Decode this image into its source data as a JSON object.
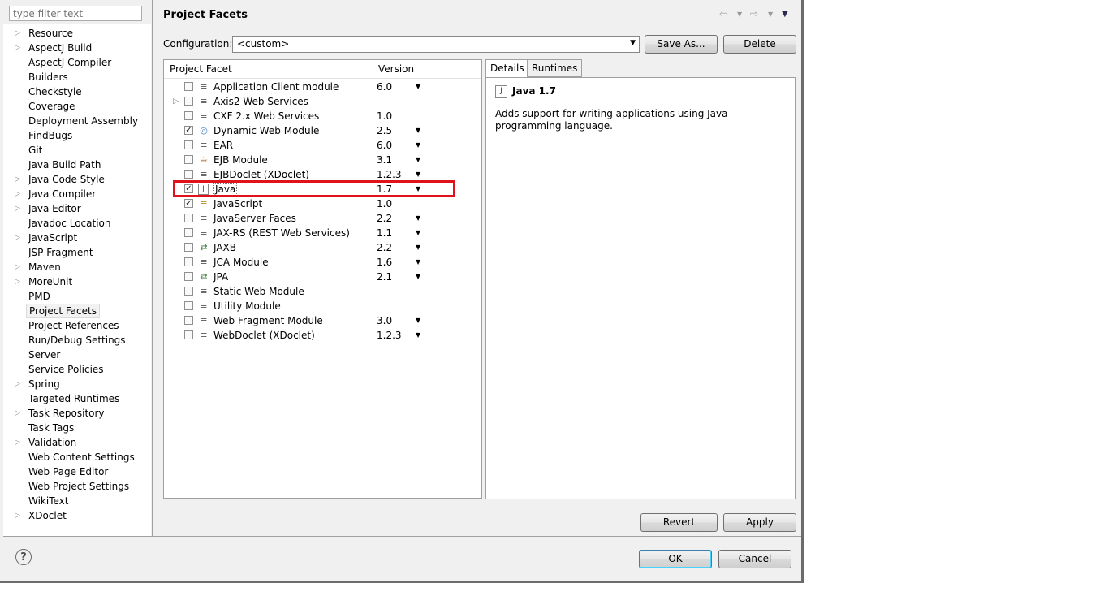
{
  "filter": {
    "placeholder": "type filter text"
  },
  "tree": {
    "items": [
      {
        "label": "Resource",
        "expandable": true
      },
      {
        "label": "AspectJ Build",
        "expandable": true
      },
      {
        "label": "AspectJ Compiler",
        "expandable": false
      },
      {
        "label": "Builders",
        "expandable": false
      },
      {
        "label": "Checkstyle",
        "expandable": false
      },
      {
        "label": "Coverage",
        "expandable": false
      },
      {
        "label": "Deployment Assembly",
        "expandable": false
      },
      {
        "label": "FindBugs",
        "expandable": false
      },
      {
        "label": "Git",
        "expandable": false
      },
      {
        "label": "Java Build Path",
        "expandable": false
      },
      {
        "label": "Java Code Style",
        "expandable": true
      },
      {
        "label": "Java Compiler",
        "expandable": true
      },
      {
        "label": "Java Editor",
        "expandable": true
      },
      {
        "label": "Javadoc Location",
        "expandable": false
      },
      {
        "label": "JavaScript",
        "expandable": true
      },
      {
        "label": "JSP Fragment",
        "expandable": false
      },
      {
        "label": "Maven",
        "expandable": true
      },
      {
        "label": "MoreUnit",
        "expandable": true
      },
      {
        "label": "PMD",
        "expandable": false
      },
      {
        "label": "Project Facets",
        "expandable": false,
        "selected": true
      },
      {
        "label": "Project References",
        "expandable": false
      },
      {
        "label": "Run/Debug Settings",
        "expandable": false
      },
      {
        "label": "Server",
        "expandable": false
      },
      {
        "label": "Service Policies",
        "expandable": false
      },
      {
        "label": "Spring",
        "expandable": true
      },
      {
        "label": "Targeted Runtimes",
        "expandable": false
      },
      {
        "label": "Task Repository",
        "expandable": true
      },
      {
        "label": "Task Tags",
        "expandable": false
      },
      {
        "label": "Validation",
        "expandable": true
      },
      {
        "label": "Web Content Settings",
        "expandable": false
      },
      {
        "label": "Web Page Editor",
        "expandable": false
      },
      {
        "label": "Web Project Settings",
        "expandable": false
      },
      {
        "label": "WikiText",
        "expandable": false
      },
      {
        "label": "XDoclet",
        "expandable": true
      }
    ]
  },
  "page": {
    "title": "Project Facets"
  },
  "config": {
    "label": "Configuration:",
    "value": "<custom>",
    "save_as": "Save As...",
    "delete": "Delete"
  },
  "facets": {
    "header": {
      "facet": "Project Facet",
      "version": "Version"
    },
    "rows": [
      {
        "name": "Application Client module",
        "version": "6.0",
        "checked": false,
        "dropdown": true,
        "expandable": false,
        "icon": "doc-icon"
      },
      {
        "name": "Axis2 Web Services",
        "version": "",
        "checked": false,
        "dropdown": false,
        "expandable": true,
        "icon": "doc-icon"
      },
      {
        "name": "CXF 2.x Web Services",
        "version": "1.0",
        "checked": false,
        "dropdown": false,
        "expandable": false,
        "icon": "doc-icon"
      },
      {
        "name": "Dynamic Web Module",
        "version": "2.5",
        "checked": true,
        "dropdown": true,
        "expandable": false,
        "icon": "globe-icon"
      },
      {
        "name": "EAR",
        "version": "6.0",
        "checked": false,
        "dropdown": true,
        "expandable": false,
        "icon": "doc-icon"
      },
      {
        "name": "EJB Module",
        "version": "3.1",
        "checked": false,
        "dropdown": true,
        "expandable": false,
        "icon": "bean-icon"
      },
      {
        "name": "EJBDoclet (XDoclet)",
        "version": "1.2.3",
        "checked": false,
        "dropdown": true,
        "expandable": false,
        "icon": "doc-icon"
      },
      {
        "name": "Java",
        "version": "1.7",
        "checked": true,
        "dropdown": true,
        "expandable": false,
        "icon": "java-icon",
        "highlighted": true
      },
      {
        "name": "JavaScript",
        "version": "1.0",
        "checked": true,
        "dropdown": false,
        "expandable": false,
        "icon": "lock-doc-icon"
      },
      {
        "name": "JavaServer Faces",
        "version": "2.2",
        "checked": false,
        "dropdown": true,
        "expandable": false,
        "icon": "doc-icon"
      },
      {
        "name": "JAX-RS (REST Web Services)",
        "version": "1.1",
        "checked": false,
        "dropdown": true,
        "expandable": false,
        "icon": "doc-icon"
      },
      {
        "name": "JAXB",
        "version": "2.2",
        "checked": false,
        "dropdown": true,
        "expandable": false,
        "icon": "arrows-icon"
      },
      {
        "name": "JCA Module",
        "version": "1.6",
        "checked": false,
        "dropdown": true,
        "expandable": false,
        "icon": "doc-icon"
      },
      {
        "name": "JPA",
        "version": "2.1",
        "checked": false,
        "dropdown": true,
        "expandable": false,
        "icon": "arrows-icon"
      },
      {
        "name": "Static Web Module",
        "version": "",
        "checked": false,
        "dropdown": false,
        "expandable": false,
        "icon": "doc-icon"
      },
      {
        "name": "Utility Module",
        "version": "",
        "checked": false,
        "dropdown": false,
        "expandable": false,
        "icon": "doc-icon"
      },
      {
        "name": "Web Fragment Module",
        "version": "3.0",
        "checked": false,
        "dropdown": true,
        "expandable": false,
        "icon": "doc-icon"
      },
      {
        "name": "WebDoclet (XDoclet)",
        "version": "1.2.3",
        "checked": false,
        "dropdown": true,
        "expandable": false,
        "icon": "doc-icon"
      }
    ]
  },
  "details": {
    "tabs": [
      "Details",
      "Runtimes"
    ],
    "title": "Java 1.7",
    "description": "Adds support for writing applications using Java programming language."
  },
  "buttons": {
    "revert": "Revert",
    "apply": "Apply",
    "ok": "OK",
    "cancel": "Cancel"
  },
  "help": {
    "glyph": "?"
  },
  "colors": {
    "highlight": "#e0121b",
    "dialog_bg": "#f0f0f0"
  }
}
